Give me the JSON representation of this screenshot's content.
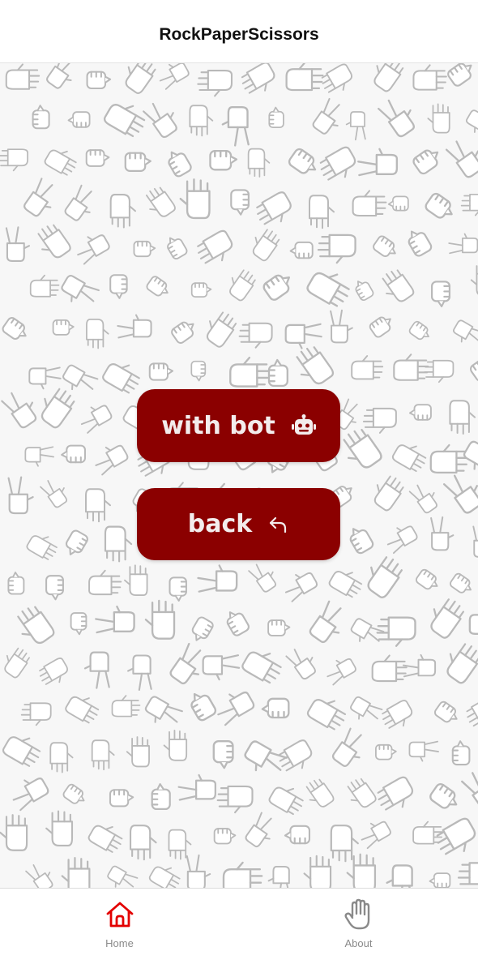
{
  "header": {
    "title": "RockPaperScissors"
  },
  "menu": {
    "with_bot_label": "with bot",
    "with_bot_icon": "robot-icon",
    "back_label": "back",
    "back_icon": "return-arrow-icon"
  },
  "tabs": [
    {
      "label": "Home",
      "icon": "home-icon",
      "active": true,
      "color": "#e30000"
    },
    {
      "label": "About",
      "icon": "hand-icon",
      "active": false,
      "color": "#8a8a8a"
    }
  ],
  "colors": {
    "accent": "#8b0000",
    "button_text": "#f3ecec",
    "pattern_stroke": "#b9b9b9",
    "tab_active": "#e30000"
  },
  "background": {
    "pattern": "hand-doodle-pattern"
  }
}
